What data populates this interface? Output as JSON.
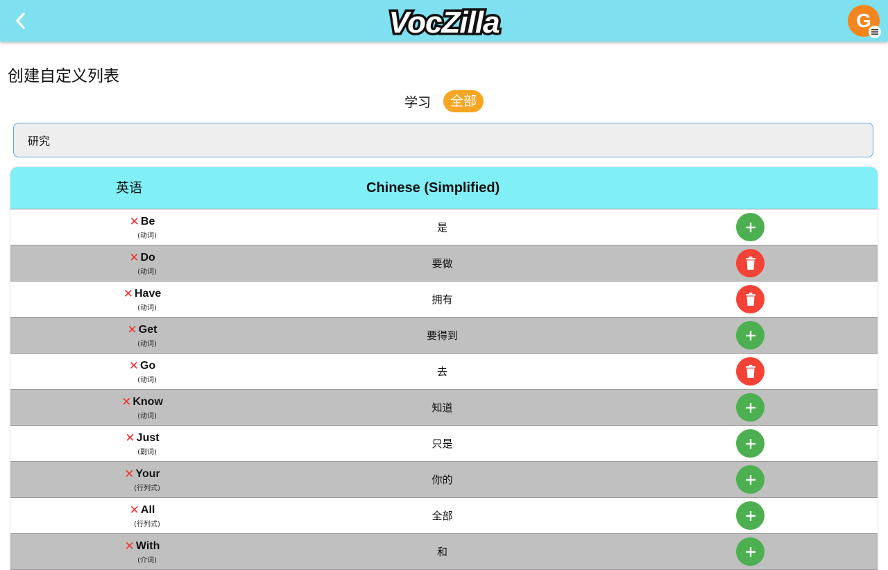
{
  "app": {
    "logo_text": "VocZilla",
    "avatar_initial": "G"
  },
  "page": {
    "title": "创建自定义列表",
    "filter_label": "学习",
    "filter_pill": "全部"
  },
  "search": {
    "value": "研究"
  },
  "table": {
    "headers": {
      "english": "英语",
      "chinese": "Chinese (Simplified)"
    },
    "rows": [
      {
        "word": "Be",
        "pos": "(动词)",
        "translation": "是",
        "action": "add"
      },
      {
        "word": "Do",
        "pos": "(动词)",
        "translation": "要做",
        "action": "delete"
      },
      {
        "word": "Have",
        "pos": "(动词)",
        "translation": "拥有",
        "action": "delete"
      },
      {
        "word": "Get",
        "pos": "(动词)",
        "translation": "要得到",
        "action": "add"
      },
      {
        "word": "Go",
        "pos": "(动词)",
        "translation": "去",
        "action": "delete"
      },
      {
        "word": "Know",
        "pos": "(动词)",
        "translation": "知道",
        "action": "add"
      },
      {
        "word": "Just",
        "pos": "(副词)",
        "translation": "只是",
        "action": "add"
      },
      {
        "word": "Your",
        "pos": "(行列式)",
        "translation": "你的",
        "action": "add"
      },
      {
        "word": "All",
        "pos": "(行列式)",
        "translation": "全部",
        "action": "add"
      },
      {
        "word": "With",
        "pos": "(介词)",
        "translation": "和",
        "action": "add"
      }
    ]
  },
  "colors": {
    "header_bg": "#7fe0f0",
    "table_header_bg": "#80eff6",
    "row_alt_bg": "#c0c0c0",
    "add_button": "#4caf50",
    "delete_button": "#f44336",
    "accent_pill": "#f6a623",
    "avatar_bg": "#f5851f",
    "remove_x": "#ee3333"
  },
  "icons": {
    "back": "chevron-left-icon",
    "add": "plus-icon",
    "delete": "trash-icon",
    "remove": "close-x-icon",
    "menu": "hamburger-menu-icon"
  }
}
